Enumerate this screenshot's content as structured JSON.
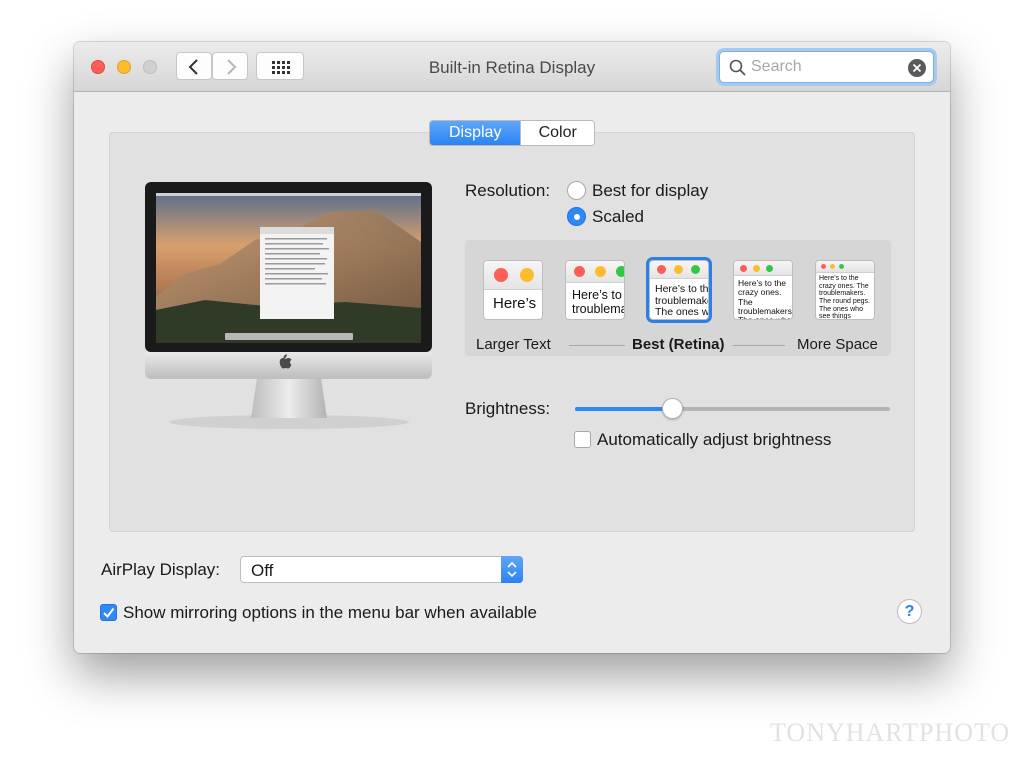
{
  "window": {
    "title": "Built-in Retina Display"
  },
  "toolbar": {
    "back_icon": "chevron-left-icon",
    "forward_icon": "chevron-right-icon",
    "grid_icon": "grid-icon"
  },
  "search": {
    "placeholder": "Search",
    "value": ""
  },
  "tabs": [
    {
      "label": "Display",
      "active": true
    },
    {
      "label": "Color",
      "active": false
    }
  ],
  "resolution": {
    "label": "Resolution:",
    "options": [
      {
        "label": "Best for display",
        "selected": false
      },
      {
        "label": "Scaled",
        "selected": true
      }
    ]
  },
  "scaling": {
    "thumbnails": [
      {
        "text": "Here’s"
      },
      {
        "text": "Here’s to the troublemakers."
      },
      {
        "text": "Here’s to the troublemakers. The ones who see"
      },
      {
        "text": "Here’s to the crazy ones. The troublemakers. The ones who see things differently. They’re not fond of rules. And they"
      },
      {
        "text": "Here’s to the crazy ones. The troublemakers. The round pegs. The ones who see things differently. They’re not fond of rules. And they have no respect. You can quote them, disagree. About the only thing. Because they change things."
      }
    ],
    "selected_index": 2,
    "labels": {
      "left": "Larger Text",
      "center": "Best (Retina)",
      "right": "More Space"
    }
  },
  "brightness": {
    "label": "Brightness:",
    "value": 0.31,
    "auto_label": "Automatically adjust brightness",
    "auto_checked": false
  },
  "airplay": {
    "label": "AirPlay Display:",
    "value": "Off"
  },
  "mirroring": {
    "label": "Show mirroring options in the menu bar when available",
    "checked": true
  },
  "help": {
    "label": "?"
  },
  "watermark": "TONYHARTPHOTO",
  "colors": {
    "accent": "#2e88f5",
    "close": "#fc5f57",
    "minimize": "#fdbc2e",
    "zoom": "#d0d0d0"
  }
}
